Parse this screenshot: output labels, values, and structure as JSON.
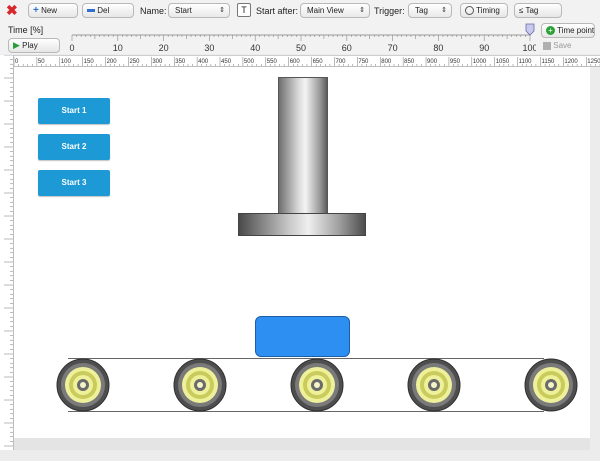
{
  "toolbar": {
    "new_label": "New",
    "del_label": "Del",
    "name_label": "Name:",
    "name_value": "Start",
    "start_after_label": "Start after:",
    "start_after_value": "Main View",
    "trigger_label": "Trigger:",
    "trigger_value": "Tag",
    "timing_label": "Timing",
    "tag_label": "Tag"
  },
  "timeline": {
    "time_label": "Time [%]",
    "play_label": "Play",
    "tick_labels": [
      "0",
      "10",
      "20",
      "30",
      "40",
      "50",
      "60",
      "70",
      "80",
      "90",
      "100"
    ],
    "slider_percent": 100,
    "time_point_label": "Time point",
    "save_label": "Save"
  },
  "ruler": {
    "h_labels": [
      "0",
      "50",
      "100",
      "150",
      "200",
      "250",
      "300",
      "350",
      "400",
      "450",
      "500",
      "550",
      "600",
      "650",
      "700",
      "750",
      "800",
      "850",
      "900",
      "950",
      "1000",
      "1050",
      "1100",
      "1150",
      "1200",
      "1250"
    ]
  },
  "canvas": {
    "buttons": [
      "Start 1",
      "Start 2",
      "Start 3"
    ],
    "colors": {
      "button": "#1d9ad6",
      "box": "#2e8ff2",
      "roller_inner": "#eef09a"
    }
  },
  "icons": {
    "close": "close-icon",
    "new": "plus-icon",
    "del": "minus-icon",
    "text": "text-icon",
    "timing": "clock-icon",
    "play": "play-icon",
    "add": "add-icon",
    "save": "save-icon"
  }
}
